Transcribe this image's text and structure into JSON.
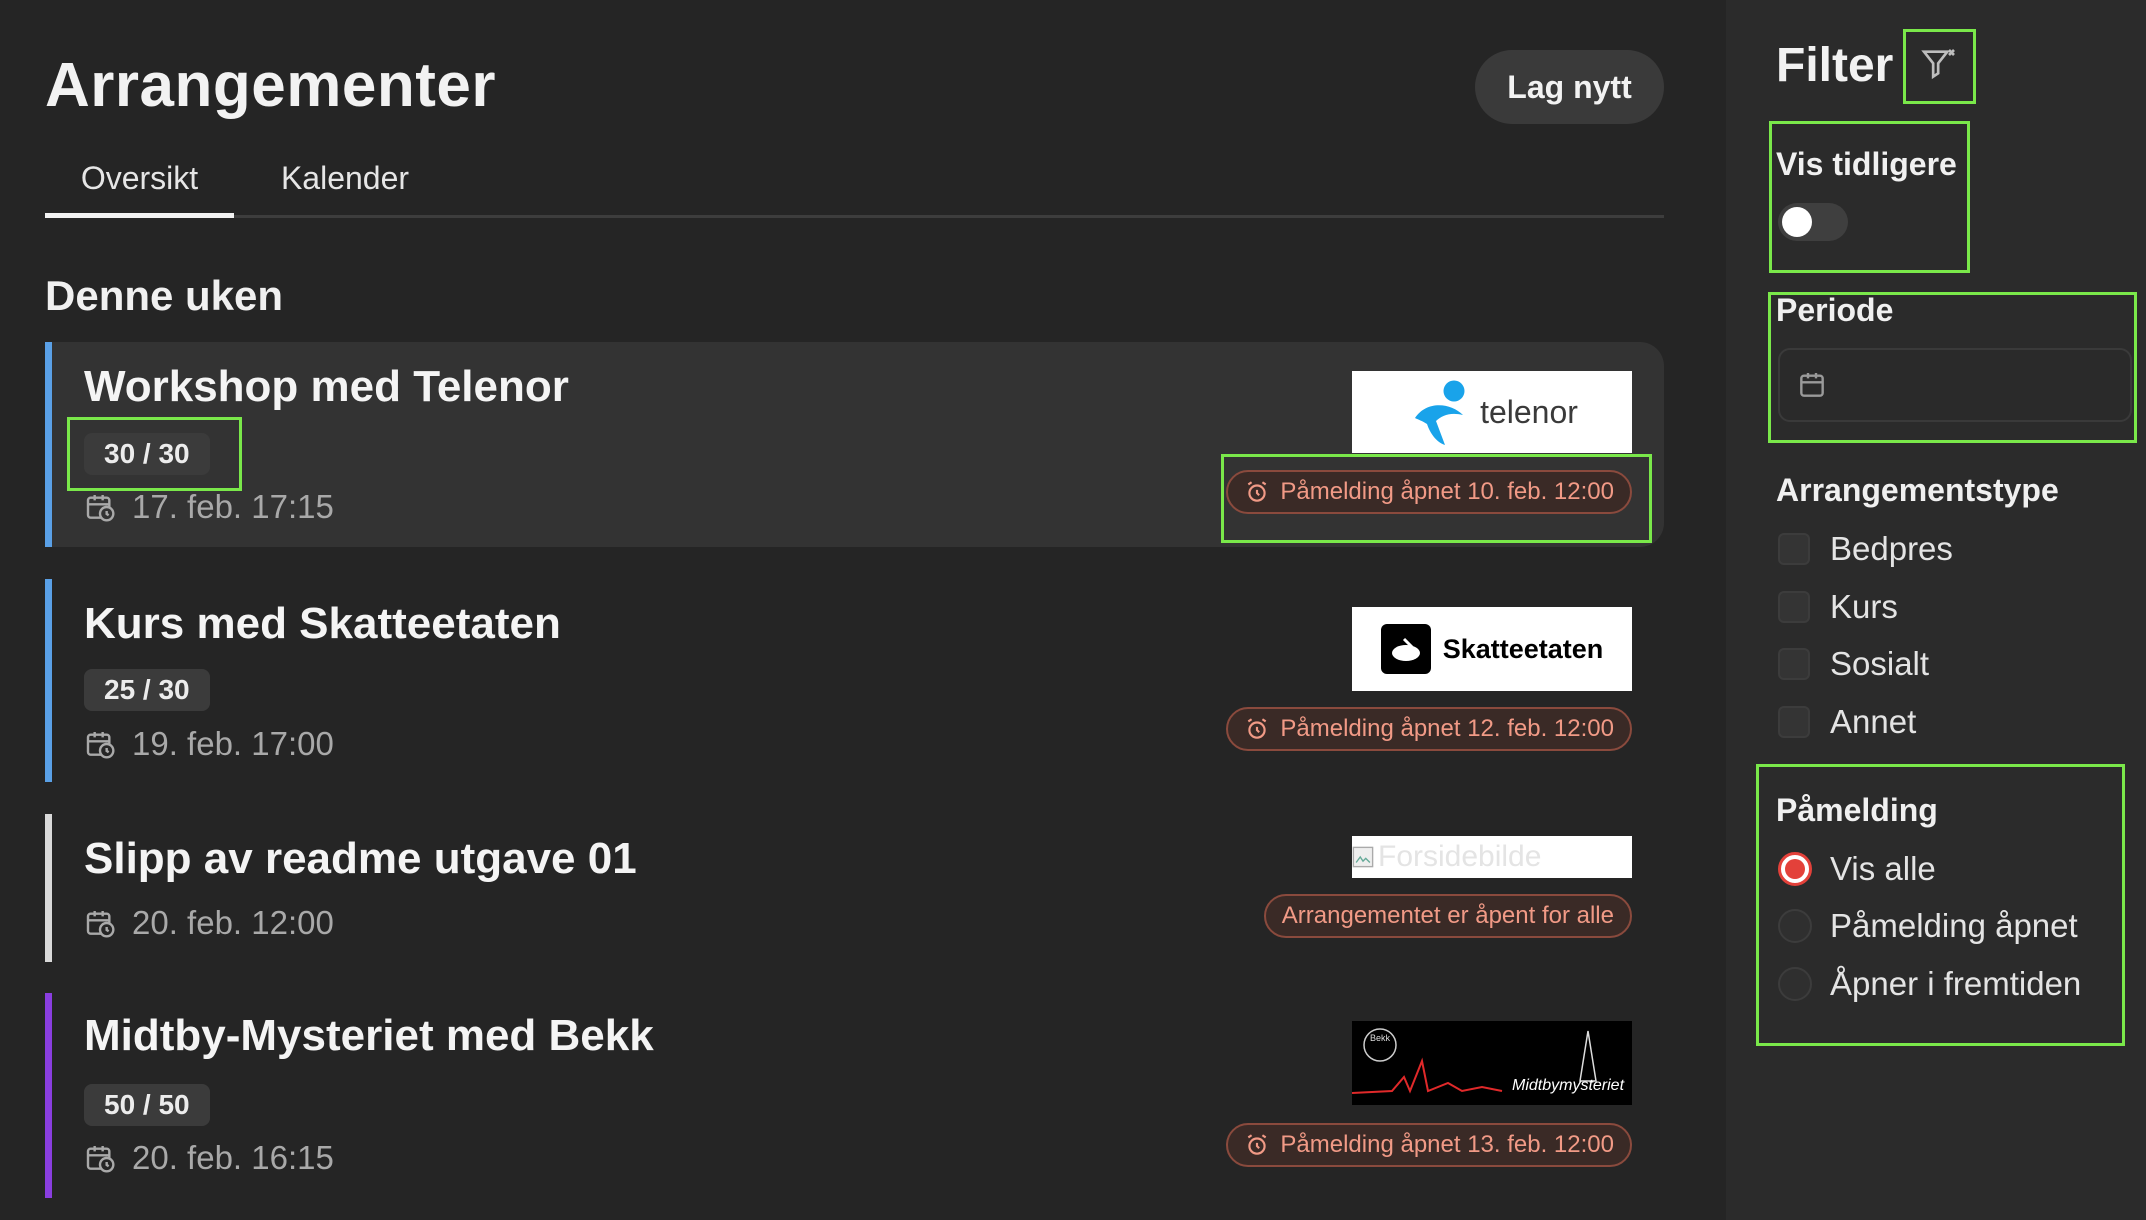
{
  "header": {
    "title": "Arrangementer",
    "new_button": "Lag nytt"
  },
  "tabs": [
    {
      "label": "Oversikt",
      "active": true
    },
    {
      "label": "Kalender",
      "active": false
    }
  ],
  "section_title": "Denne uken",
  "events": [
    {
      "title": "Workshop med Telenor",
      "count": "30 / 30",
      "date": "17. feb. 17:15",
      "badge": "Påmelding åpnet 10. feb. 12:00",
      "logo_text": "telenor",
      "bar_color": "#5aa0e6"
    },
    {
      "title": "Kurs med Skatteetaten",
      "count": "25 / 30",
      "date": "19. feb. 17:00",
      "badge": "Påmelding åpnet 12. feb. 12:00",
      "logo_text": "Skatteetaten",
      "bar_color": "#5aa0e6"
    },
    {
      "title": "Slipp av readme utgave 01",
      "date": "20. feb. 12:00",
      "badge": "Arrangementet er åpent for alle",
      "logo_text": "Forsidebilde",
      "bar_color": "#d9d9d9"
    },
    {
      "title": "Midtby-Mysteriet med Bekk",
      "count": "50 / 50",
      "date": "20. feb. 16:15",
      "badge": "Påmelding åpnet 13. feb. 12:00",
      "logo_text": "Midtbymysteriet",
      "logo_small": "Bekk",
      "bar_color": "#8a3ee0"
    }
  ],
  "filter": {
    "title": "Filter",
    "show_earlier": {
      "label": "Vis tidligere",
      "on": false
    },
    "period": {
      "label": "Periode",
      "value": ""
    },
    "event_type": {
      "label": "Arrangementstype",
      "options": [
        "Bedpres",
        "Kurs",
        "Sosialt",
        "Annet"
      ]
    },
    "registration": {
      "label": "Påmelding",
      "options": [
        "Vis alle",
        "Påmelding åpnet",
        "Åpner i fremtiden"
      ],
      "selected": "Vis alle"
    }
  },
  "colors": {
    "accent_red": "#e3413a",
    "badge_text": "#f19a86",
    "highlight": "#7ae84a"
  }
}
